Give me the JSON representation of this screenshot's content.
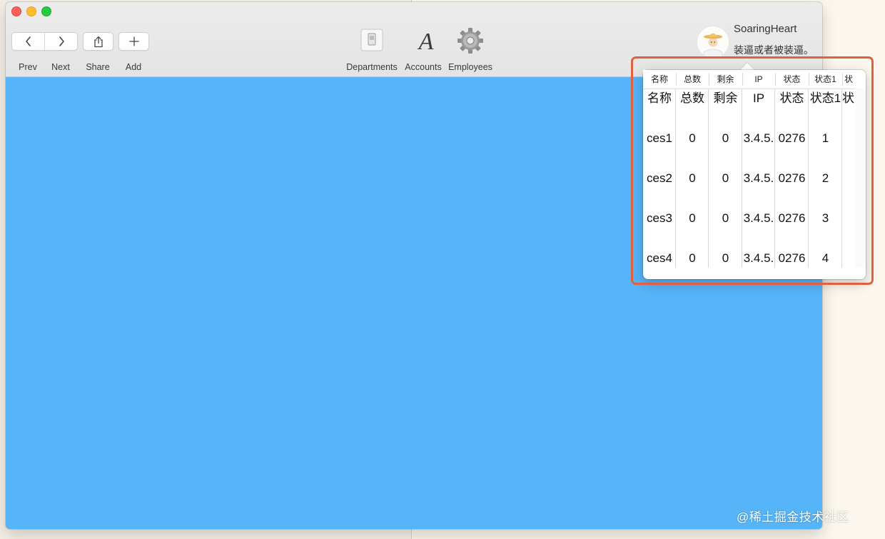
{
  "toolbar": {
    "prev_label": "Prev",
    "next_label": "Next",
    "share_label": "Share",
    "add_label": "Add",
    "departments_label": "Departments",
    "accounts_label": "Accounts",
    "employees_label": "Employees"
  },
  "user": {
    "name": "SoaringHeart",
    "motto": "装逼或者被装逼。"
  },
  "popover_table": {
    "headers": [
      "名称",
      "总数",
      "剩余",
      "IP",
      "状态",
      "状态1",
      "状"
    ],
    "rows": [
      [
        "名称",
        "总数",
        "剩余",
        "IP",
        "状态",
        "状态1",
        "状"
      ],
      [
        "ces1",
        "0",
        "0",
        "3.4.5.",
        "0276",
        "1",
        ""
      ],
      [
        "ces2",
        "0",
        "0",
        "3.4.5.",
        "0276",
        "2",
        ""
      ],
      [
        "ces3",
        "0",
        "0",
        "3.4.5.",
        "0276",
        "3",
        ""
      ],
      [
        "ces4",
        "0",
        "0",
        "3.4.5.",
        "0276",
        "4",
        ""
      ]
    ]
  },
  "watermark": "@稀土掘金技术社区",
  "colors": {
    "content_bg": "#56b4f8",
    "highlight_border": "#e0613f"
  }
}
